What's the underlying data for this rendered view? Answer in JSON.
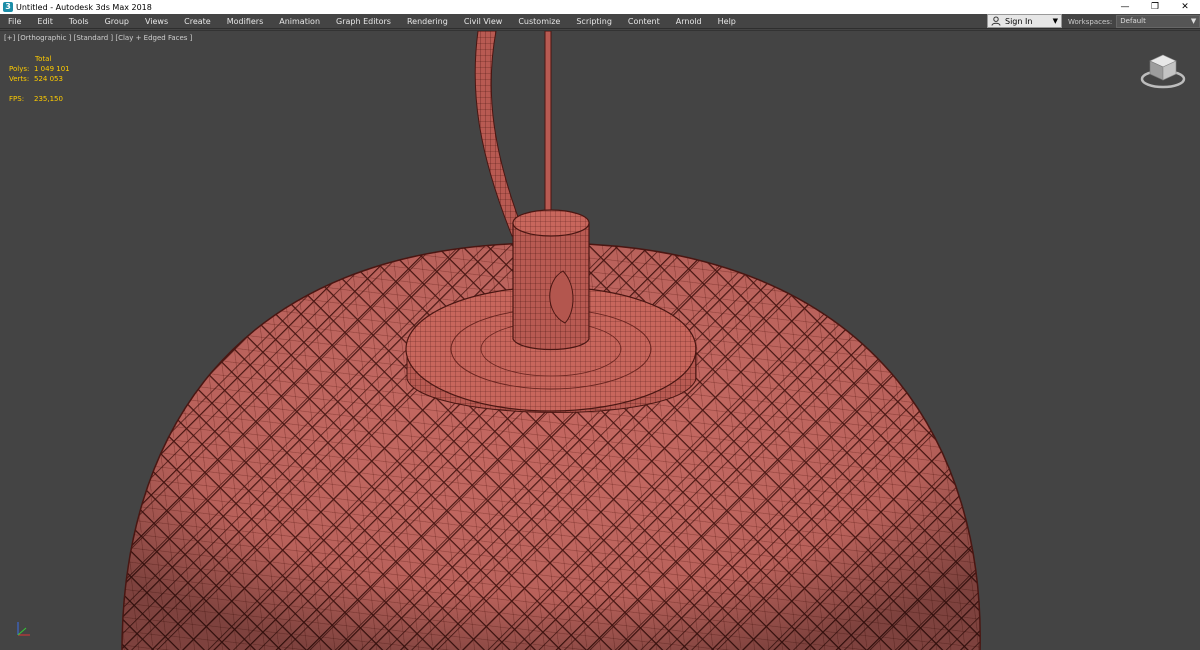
{
  "window": {
    "title": "Untitled - Autodesk 3ds Max 2018",
    "app_icon": "3ds-max-icon",
    "controls": {
      "minimize": "—",
      "restore": "❐",
      "close": "✕"
    }
  },
  "menu": {
    "items": [
      "File",
      "Edit",
      "Tools",
      "Group",
      "Views",
      "Create",
      "Modifiers",
      "Animation",
      "Graph Editors",
      "Rendering",
      "Civil View",
      "Customize",
      "Scripting",
      "Content",
      "Arnold",
      "Help"
    ]
  },
  "account": {
    "signin_label": "Sign In",
    "icon": "user-icon"
  },
  "workspaces": {
    "label": "Workspaces:",
    "value": "Default"
  },
  "viewport": {
    "label": "[+] [Orthographic ] [Standard ] [Clay + Edged Faces ]",
    "stats": {
      "header": "Total",
      "polys_label": "Polys:",
      "polys_value": "1 049 101",
      "verts_label": "Verts:",
      "verts_value": "524 053",
      "fps_label": "FPS:",
      "fps_value": "235,150"
    },
    "model_color": "#c2665f",
    "wire_color": "#5a1f1a",
    "viewcube_icon": "viewcube-icon",
    "gizmo_icon": "axis-gizmo-icon"
  }
}
